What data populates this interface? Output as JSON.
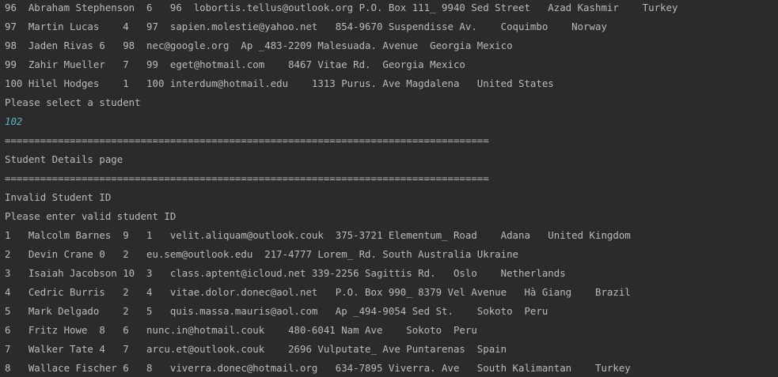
{
  "console": {
    "lines": [
      {
        "text": "96  Abraham Stephenson  6   96  lobortis.tellus@outlook.org P.O. Box 111_ 9940 Sed Street   Azad Kashmir    Turkey",
        "kind": "output"
      },
      {
        "text": "97  Martin Lucas    4   97  sapien.molestie@yahoo.net   854-9670 Suspendisse Av.    Coquimbo    Norway",
        "kind": "output"
      },
      {
        "text": "98  Jaden Rivas 6   98  nec@google.org  Ap _483-2209 Malesuada. Avenue  Georgia Mexico",
        "kind": "output"
      },
      {
        "text": "99  Zahir Mueller   7   99  eget@hotmail.com    8467 Vitae Rd.  Georgia Mexico",
        "kind": "output"
      },
      {
        "text": "100 Hilel Hodges    1   100 interdum@hotmail.edu    1313 Purus. Ave Magdalena   United States",
        "kind": "output"
      },
      {
        "text": "Please select a student",
        "kind": "output"
      },
      {
        "text": "102",
        "kind": "input"
      },
      {
        "text": "==================================================================================",
        "kind": "output"
      },
      {
        "text": "Student Details page",
        "kind": "output"
      },
      {
        "text": "==================================================================================",
        "kind": "output"
      },
      {
        "text": "Invalid Student ID",
        "kind": "output"
      },
      {
        "text": "Please enter valid student ID",
        "kind": "output"
      },
      {
        "text": "1   Malcolm Barnes  9   1   velit.aliquam@outlook.couk  375-3721 Elementum_ Road    Adana   United Kingdom",
        "kind": "output"
      },
      {
        "text": "2   Devin Crane 0   2   eu.sem@outlook.edu  217-4777 Lorem_ Rd. South Australia Ukraine",
        "kind": "output"
      },
      {
        "text": "3   Isaiah Jacobson 10  3   class.aptent@icloud.net 339-2256 Sagittis Rd.   Oslo    Netherlands",
        "kind": "output"
      },
      {
        "text": "4   Cedric Burris   2   4   vitae.dolor.donec@aol.net   P.O. Box 990_ 8379 Vel Avenue   Hà Giang    Brazil",
        "kind": "output"
      },
      {
        "text": "5   Mark Delgado    2   5   quis.massa.mauris@aol.com   Ap _494-9054 Sed St.    Sokoto  Peru",
        "kind": "output"
      },
      {
        "text": "6   Fritz Howe  8   6   nunc.in@hotmail.couk    480-6041 Nam Ave    Sokoto  Peru",
        "kind": "output"
      },
      {
        "text": "7   Walker Tate 4   7   arcu.et@outlook.couk    2696 Vulputate_ Ave Puntarenas  Spain",
        "kind": "output"
      },
      {
        "text": "8   Wallace Fischer 6   8   viverra.donec@hotmail.org   634-7895 Viverra. Ave   South Kalimantan    Turkey",
        "kind": "output"
      }
    ]
  }
}
